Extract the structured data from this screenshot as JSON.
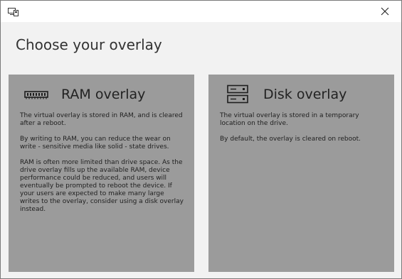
{
  "window": {
    "icon": "overlay-app-icon",
    "close_icon": "close-icon"
  },
  "page": {
    "title": "Choose your overlay"
  },
  "options": [
    {
      "title": "RAM overlay",
      "icon": "ram-memory-icon",
      "paragraphs": [
        "The virtual overlay is stored in RAM, and is cleared after a reboot.",
        "By writing to RAM, you can reduce the wear on write - sensitive media like solid - state drives.",
        "RAM is often more limited than drive space. As the drive overlay fills up the available RAM, device performance could be reduced, and users will eventually be prompted to reboot the device. If your users are expected to make many large writes to the overlay, consider using a disk overlay instead."
      ]
    },
    {
      "title": "Disk overlay",
      "icon": "disk-drive-icon",
      "paragraphs": [
        "The virtual overlay is stored in a temporary location on the drive.",
        "By default, the overlay is cleared on reboot."
      ]
    }
  ],
  "colors": {
    "card_background": "#9b9b9b",
    "window_background": "#f2f2f2",
    "titlebar_background": "#ffffff"
  }
}
